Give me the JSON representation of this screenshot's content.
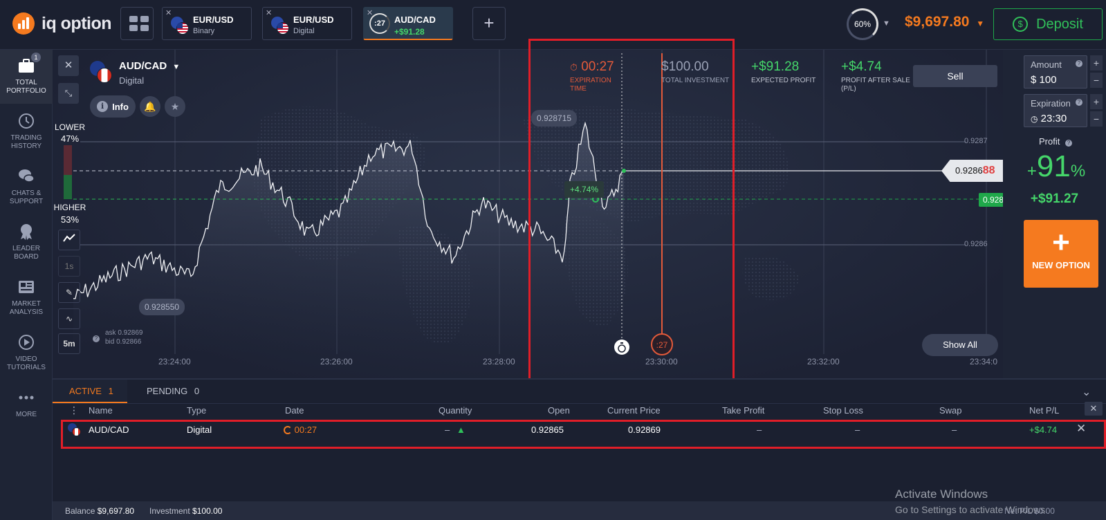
{
  "topbar": {
    "logo_text": "iq option",
    "tabs": [
      {
        "name": "EUR/USD",
        "sub": "Binary"
      },
      {
        "name": "EUR/USD",
        "sub": "Digital"
      },
      {
        "name": "AUD/CAD",
        "sub": "+$91.28",
        "timer": ":27"
      }
    ],
    "close_glyph": "✕",
    "plus_glyph": "+",
    "progress_label": "60%",
    "progress_value": 0.6,
    "balance": "$9,697.80",
    "deposit_label": "Deposit"
  },
  "leftnav": {
    "items": [
      {
        "label": "Total portfolio",
        "icon": "briefcase-icon",
        "badge": "1"
      },
      {
        "label": "Trading history",
        "icon": "clock-history-icon"
      },
      {
        "label": "Chats & support",
        "icon": "chat-bubbles-icon"
      },
      {
        "label": "Leader board",
        "icon": "medal-icon"
      },
      {
        "label": "Market analysis",
        "icon": "newspaper-icon"
      },
      {
        "label": "Video tutorials",
        "icon": "play-circle-icon"
      },
      {
        "label": "More",
        "icon": "more-dots-icon"
      }
    ]
  },
  "chart": {
    "pair": "AUD/CAD",
    "pair_type": "Digital",
    "info_label": "Info",
    "lower_label": "LOWER",
    "lower_pct": "47%",
    "higher_label": "HIGHER",
    "higher_pct": "53%",
    "interval_1s": "1s",
    "interval_5m": "5m",
    "ask": "ask 0.92869",
    "bid": "bid 0.92866",
    "high_tag": "0.928715",
    "low_tag": "0.928550",
    "y_labels": [
      "0.9287",
      "0.9286"
    ],
    "x_labels": [
      "23:24:00",
      "23:26:00",
      "23:28:00",
      "23:30:00",
      "23:32:00",
      "23:34:0"
    ],
    "expiration_value": "00:27",
    "expiration_label": "EXPIRATION TIME",
    "investment_value": "$100.00",
    "investment_label": "TOTAL INVESTMENT",
    "expected_value": "+$91.28",
    "expected_label": "EXPECTED PROFIT",
    "aftersale_value": "+$4.74",
    "aftersale_label": "PROFIT AFTER SALE (P/L)",
    "sell_label": "Sell",
    "show_all_label": "Show All",
    "current_price_main": "0.9286",
    "current_price_tail": "88",
    "open_price": "0.92865",
    "pl_chip": "+4.74%",
    "expiry_countdown": ":27"
  },
  "rightpanel": {
    "amount_label": "Amount",
    "amount_value": "$ 100",
    "expiration_label": "Expiration",
    "expiration_value": "23:30",
    "profit_label": "Profit",
    "profit_sign": "+",
    "profit_num": "91",
    "profit_unit": "%",
    "profit_abs": "+$91.27",
    "new_option_label": "NEW OPTION"
  },
  "bottom": {
    "tabs": [
      {
        "label": "ACTIVE",
        "count": "1"
      },
      {
        "label": "PENDING",
        "count": "0"
      }
    ],
    "columns": [
      "Name",
      "Type",
      "Date",
      "Quantity",
      "Open",
      "Current Price",
      "Take Profit",
      "Stop Loss",
      "Swap",
      "Net P/L"
    ],
    "row": {
      "name": "AUD/CAD",
      "type": "Digital",
      "date": "00:27",
      "quantity": "–",
      "open": "0.92865",
      "current": "0.92869",
      "take_profit": "–",
      "stop_loss": "–",
      "swap": "–",
      "net_pl": "+$4.74"
    },
    "windows_title": "Activate Windows",
    "windows_sub": "Go to Settings to activate Windows.",
    "overlay_pl": "Net P/L $0.00"
  },
  "footer": {
    "balance_label": "Balance",
    "balance_value": "$9,697.80",
    "investment_label": "Investment",
    "investment_value": "$100.00"
  },
  "colors": {
    "accent": "#f57a1f",
    "green": "#45d66a",
    "red_box": "#e01e28",
    "bg": "#1b2030"
  }
}
